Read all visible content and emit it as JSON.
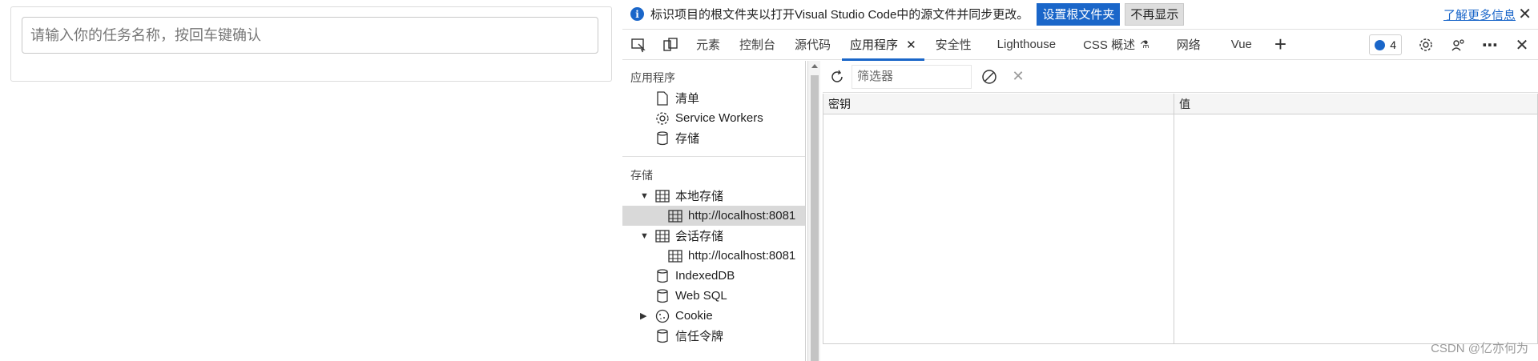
{
  "page": {
    "input_placeholder": "请输入你的任务名称，按回车键确认"
  },
  "infobar": {
    "message": "标识项目的根文件夹以打开Visual Studio Code中的源文件并同步更改。",
    "set_root_label": "设置根文件夹",
    "dont_show_label": "不再显示",
    "learn_more_label": "了解更多信息"
  },
  "tabs": {
    "items": [
      "元素",
      "控制台",
      "源代码",
      "应用程序",
      "安全性",
      "Lighthouse",
      "CSS 概述",
      "网络",
      "Vue"
    ],
    "active": "应用程序",
    "issues_count": "4"
  },
  "sidebar": {
    "app_section": "应用程序",
    "app_items": [
      "清单",
      "Service Workers",
      "存储"
    ],
    "storage_section": "存储",
    "local_storage": "本地存储",
    "local_storage_origin": "http://localhost:8081",
    "session_storage": "会话存储",
    "session_storage_origin": "http://localhost:8081",
    "indexeddb": "IndexedDB",
    "websql": "Web SQL",
    "cookie": "Cookie",
    "trust_tokens": "信任令牌"
  },
  "storage_view": {
    "filter_placeholder": "筛选器",
    "col_key": "密钥",
    "col_value": "值"
  },
  "watermark": "CSDN @亿亦何为",
  "colors": {
    "accent": "#1a66c9"
  }
}
